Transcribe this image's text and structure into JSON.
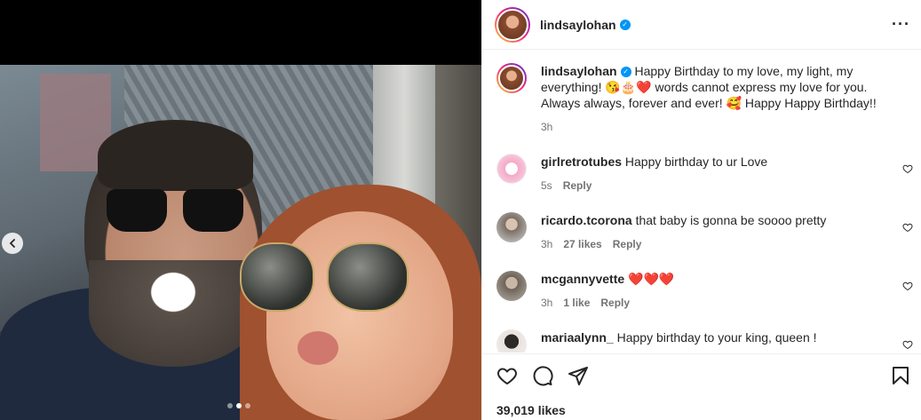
{
  "post": {
    "username": "lindsaylohan",
    "verified_icon": "verified-badge-icon",
    "more_icon": "more-options-icon",
    "carousel": {
      "prev_icon": "chevron-left-icon",
      "slide_count": 3,
      "active_slide": 2
    }
  },
  "caption": {
    "username": "lindsaylohan",
    "text": "Happy Birthday to my love, my light, my everything! 😘🎂❤️ words cannot express my love for you. Always always, forever and ever! 🥰 Happy Happy Birthday!!",
    "time": "3h"
  },
  "comments": [
    {
      "username": "girlretrotubes",
      "text": "Happy birthday to ur Love",
      "time": "5s",
      "likes": "",
      "reply": "Reply"
    },
    {
      "username": "ricardo.tcorona",
      "text": "that baby is gonna be soooo pretty",
      "time": "3h",
      "likes": "27 likes",
      "reply": "Reply"
    },
    {
      "username": "mcgannyvette",
      "text": "❤️❤️❤️",
      "time": "3h",
      "likes": "1 like",
      "reply": "Reply"
    },
    {
      "username": "mariaalynn_",
      "text": "Happy birthday to your king, queen !",
      "time": "",
      "likes": "",
      "reply": ""
    }
  ],
  "actions": {
    "like_icon": "heart-icon",
    "comment_icon": "comment-icon",
    "share_icon": "share-icon",
    "save_icon": "bookmark-icon",
    "likes": "39,019 likes"
  },
  "colors": {
    "accent": "#0095f6",
    "text": "#262626",
    "muted": "#737373",
    "border": "#efefef"
  }
}
